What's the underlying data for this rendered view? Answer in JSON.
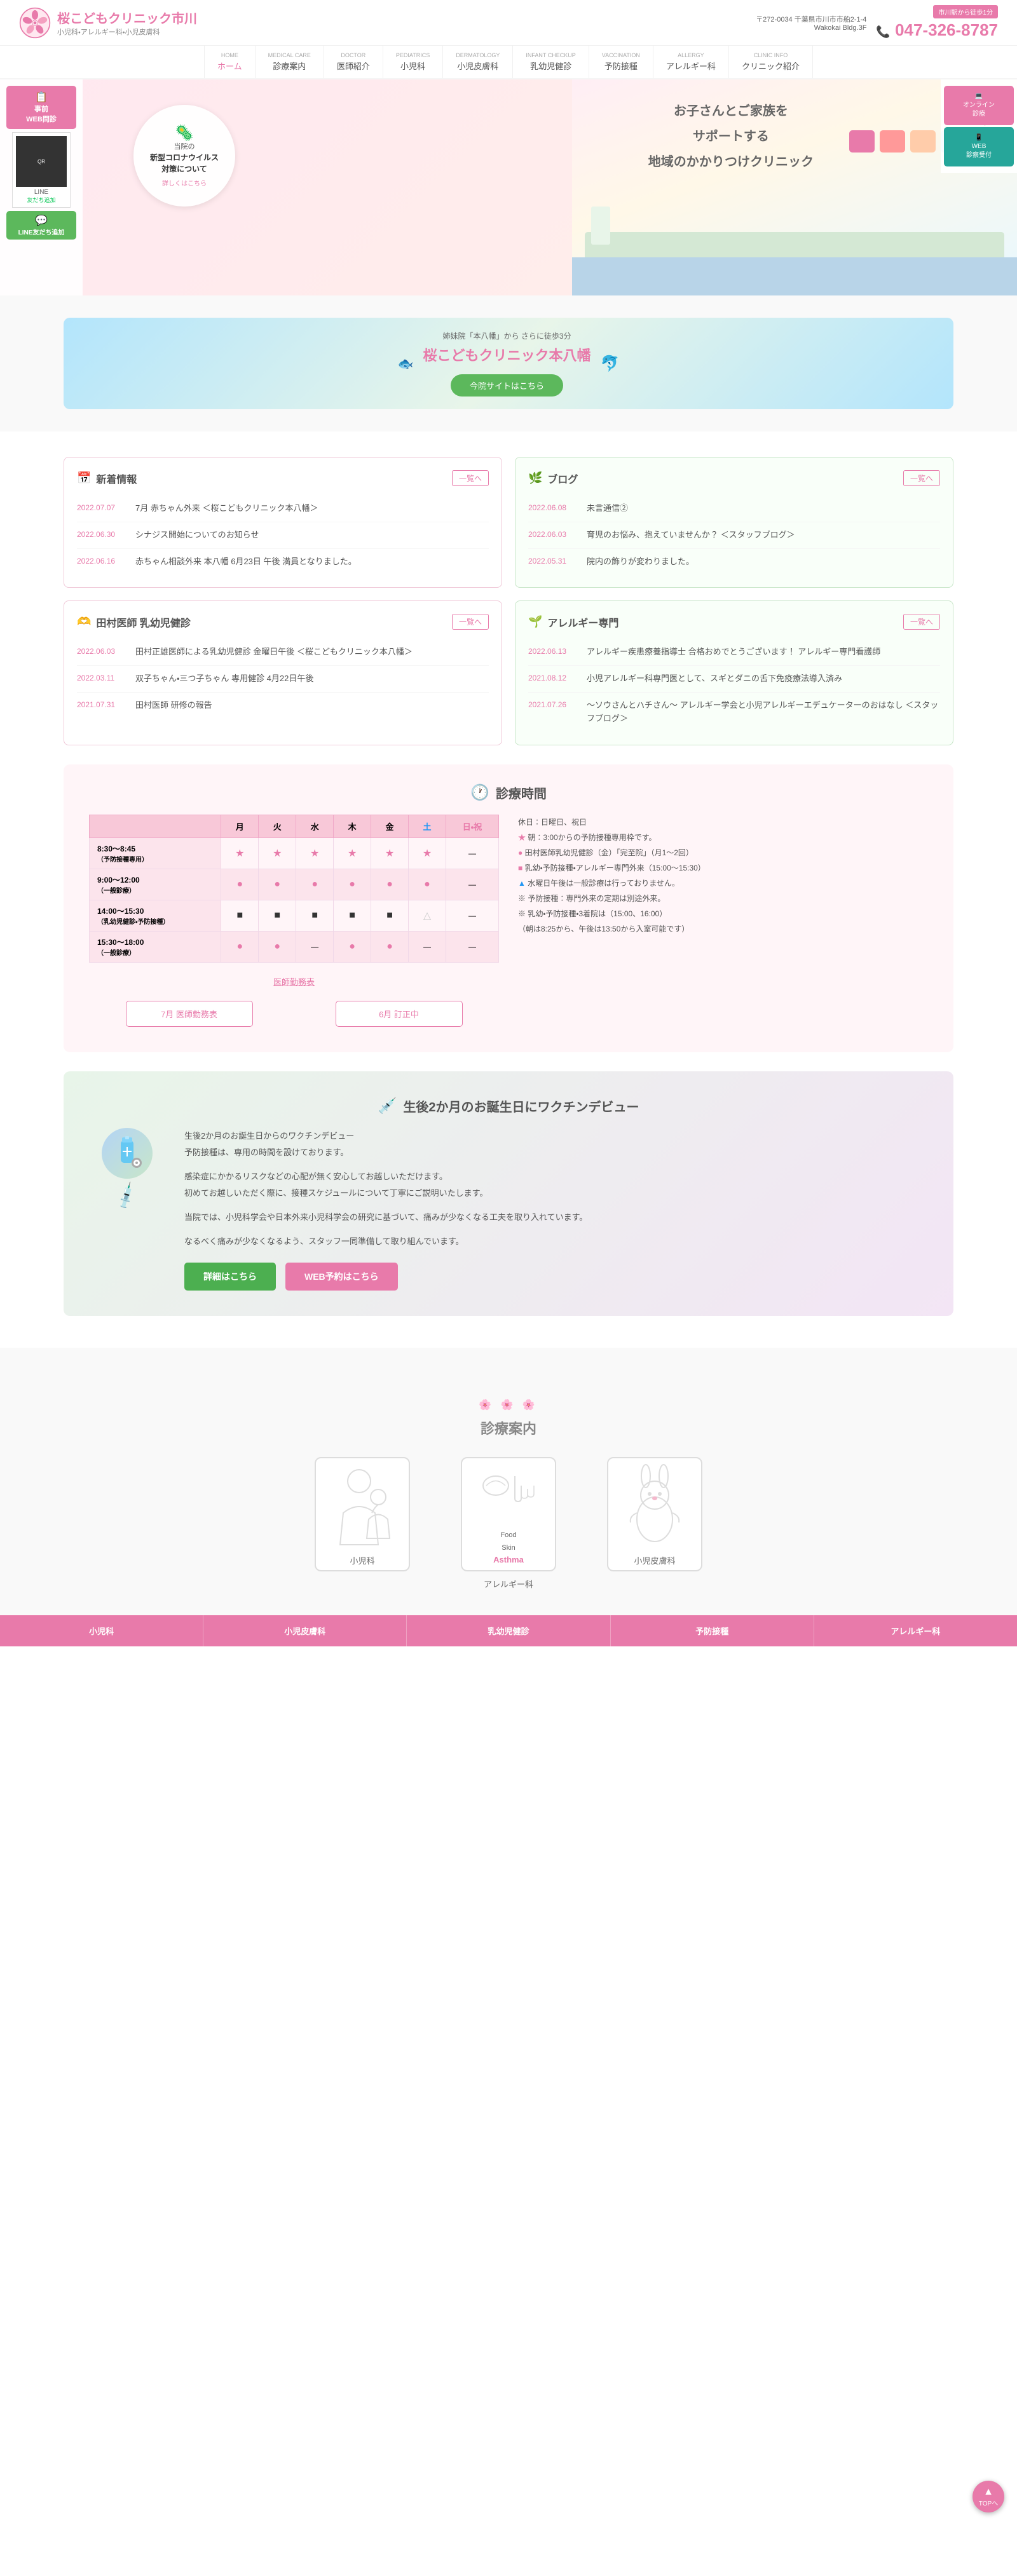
{
  "clinic": {
    "name_jp": "桜こどもクリニック市川",
    "tagline": "小児科・アレルギー科・小児皮膚科",
    "address": "〒272-0034 千葉県市川市市船2-1-4",
    "building": "Wakokai Bldg.3F",
    "phone": "047-326-8787",
    "station_badge": "市川駅から徒歩1分"
  },
  "nav": {
    "items": [
      {
        "label": "ホーム",
        "en": "HOME"
      },
      {
        "label": "診療案内",
        "en": "MEDICAL CARE"
      },
      {
        "label": "医師紹介",
        "en": "DOCTOR"
      },
      {
        "label": "小児科",
        "en": "PEDIATRICS"
      },
      {
        "label": "小児皮膚科",
        "en": "DERMATOLOGY"
      },
      {
        "label": "乳幼児健診",
        "en": "INFANT CHECKUP"
      },
      {
        "label": "予防接種",
        "en": "VACCINATION"
      },
      {
        "label": "アレルギー科",
        "en": "ALLERGY"
      },
      {
        "label": "クリニック紹介",
        "en": "CLINIC INFO"
      }
    ]
  },
  "hero": {
    "badge_title": "当院の",
    "badge_main": "新型コロナウイルス\n対策について",
    "badge_link": "詳しくはこちら",
    "main_text_line1": "お子さんとご家族を",
    "main_text_line2": "サポートする",
    "main_text_line3": "地域のかかりつけクリニック"
  },
  "side_buttons": {
    "web_consultation": "事前\nWEB問診",
    "online_consultation": "オンライン\n診療",
    "web_reception": "WEB\n診察受付",
    "line_label": "LINE",
    "line_sub": "友だち追加"
  },
  "new_clinic": {
    "subtitle": "姉妹院「本八幡」から さらに徒歩3分",
    "title": "桜こどもクリニック本八幡",
    "btn_label": "今院サイトはこちら"
  },
  "news": {
    "title": "新着情報",
    "more": "一覧へ",
    "items": [
      {
        "date": "2022.07.07",
        "text": "7月 赤ちゃん外来 ＜桜こどもクリニック本八幡＞"
      },
      {
        "date": "2022.06.30",
        "text": "シナジス開始についてのお知らせ"
      },
      {
        "date": "2022.06.16",
        "text": "赤ちゃん相談外来 本八幡 6月23日 午後 満員となりました。"
      }
    ]
  },
  "blog": {
    "title": "ブログ",
    "more": "一覧へ",
    "items": [
      {
        "date": "2022.06.08",
        "text": "未言通信②"
      },
      {
        "date": "2022.06.03",
        "text": "育児のお悩み、抱えていませんか？ ＜スタッフブログ＞"
      },
      {
        "date": "2022.05.31",
        "text": "院内の飾りが変わりました。"
      }
    ]
  },
  "infant_checkup": {
    "title": "田村医師 乳幼児健診",
    "more": "一覧へ",
    "items": [
      {
        "date": "2022.06.03",
        "text": "田村正雄医師による乳幼児健診 金曜日午後 ＜桜こどもクリニック本八幡＞"
      },
      {
        "date": "2022.03.11",
        "text": "双子ちゃん・三つ子ちゃん 専用健診 4月22日午後"
      },
      {
        "date": "2021.07.31",
        "text": "田村医師 研修の報告"
      }
    ]
  },
  "allergy": {
    "title": "アレルギー専門",
    "more": "一覧へ",
    "items": [
      {
        "date": "2022.06.13",
        "text": "アレルギー疾患療養指導士 合格おめでとうございます！ アレルギー専門看護師"
      },
      {
        "date": "2021.08.12",
        "text": "小児アレルギー科専門医として、スギとダニの舌下免疫療法導入済み"
      },
      {
        "date": "2021.07.26",
        "text": "〜ソウさんとハチさん〜 アレルギー学会と小児アレルギーエデュケーターのおはなし ＜スタッフブログ＞"
      }
    ]
  },
  "schedule": {
    "title": "診療時間",
    "days": [
      "月",
      "火",
      "水",
      "木",
      "金",
      "土",
      "日・祝"
    ],
    "rows": [
      {
        "time": "8:30〜8:45\n（予防接種専用）",
        "slots": [
          "★",
          "★",
          "★",
          "★",
          "★",
          "★",
          "—"
        ]
      },
      {
        "time": "9:00〜12:00\n（一般診療）",
        "slots": [
          "●",
          "●",
          "●",
          "●",
          "●",
          "●",
          "—"
        ]
      },
      {
        "time": "14:00〜15:30\n（乳幼児健診・予防接種）",
        "slots": [
          "■",
          "■",
          "■",
          "■",
          "■",
          "△",
          "—"
        ]
      },
      {
        "time": "15:30〜18:00\n（一般診療）",
        "slots": [
          "●",
          "●",
          "—",
          "●",
          "●",
          "—",
          "—"
        ]
      }
    ],
    "notes": [
      "休日：日曜日、祝日",
      "★ 朝：3:00からの予防接種専用枠です。",
      "● 田村医師乳幼児健診（金）「完至院」（月1〜2回）",
      "■ 乳幼・予防接種・アレルギー専門外来（15:00〜15:30）",
      "▲ 水曜日午後は一般診療は行っておりません。",
      "※ 予防接種：専門外来の定期は別途外来。",
      "※ 乳幼・予防接種・3着院は（15:00、16:00）",
      "（朝は8:25から、午後は13:50から5入室可能です）"
    ],
    "doctor_schedule_btn": "7月 医師勤務表",
    "month_schedule_btn": "6月 訂正中"
  },
  "vaccine": {
    "title": "生後2か月のお誕生日にワクチンデビュー",
    "body_p1": "生後2か月のお誕生日からのワクチンデビュー\n予防接種は、専用の時間を設けております。",
    "body_p2": "感染症にかかるリスクなどの心配が無く安心してお越しいただけます。\n初めてお越しいただく際に、接種スケジュールについて丁寧にご説明いたします。",
    "body_p3": "当院では、小児科学会や日本外来小児科学会の研究に基づいて、痛みが少なくなる工夫を取り入れています。",
    "body_p4": "なるべく痛みが少なくなるよう、スタッフ一同準備して取り組んでいます。",
    "btn_detail": "詳細はこちら",
    "btn_web": "WEB予約はこちら"
  },
  "diagnosis": {
    "title": "診療案内",
    "flower_deco": "🌸 🌸 🌸",
    "cards": [
      {
        "label": "小児科",
        "icon": "👩‍👦",
        "sub": ""
      },
      {
        "label": "Food\nSkin\nAsthma",
        "icon": "🌿",
        "sub": "アレルギー科"
      },
      {
        "label": "小児皮膚科",
        "icon": "🐰",
        "sub": ""
      }
    ]
  },
  "bottom_nav": {
    "items": [
      "小児科",
      "小児皮膚科",
      "乳幼児健診",
      "予防接種",
      "アレルギー科"
    ]
  },
  "to_top": "TOPへ"
}
